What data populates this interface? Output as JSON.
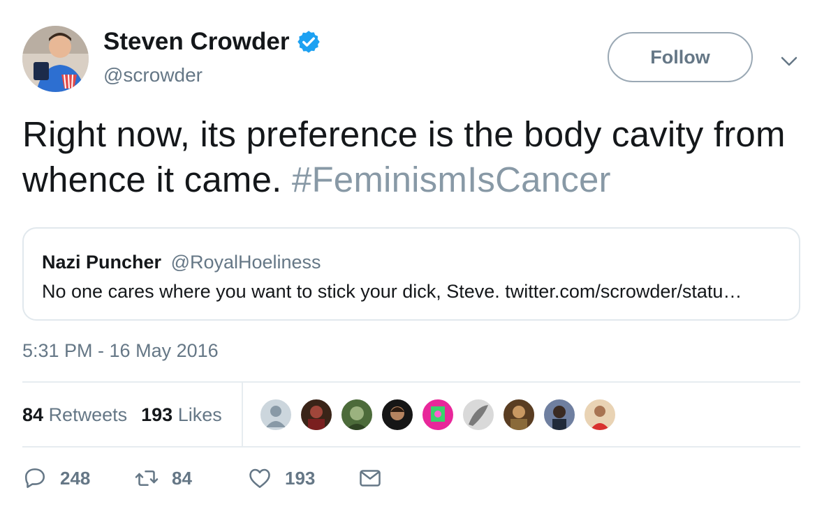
{
  "author": {
    "name": "Steven Crowder",
    "handle": "@scrowder",
    "verified": true
  },
  "follow_label": "Follow",
  "tweet": {
    "text": "Right now, its preference is the body cavity from whence it came.",
    "hashtag": "#FeminismIsCancer"
  },
  "quote": {
    "name": "Nazi Puncher",
    "handle": "@RoyalHoeliness",
    "text": "No one cares where you want to stick your dick, Steve.  twitter.com/scrowder/statu…"
  },
  "timestamp": "5:31 PM - 16 May 2016",
  "stats": {
    "retweets_count": "84",
    "retweets_label": "Retweets",
    "likes_count": "193",
    "likes_label": "Likes"
  },
  "actions": {
    "replies": "248",
    "retweets": "84",
    "likes": "193"
  },
  "colors": {
    "verified_badge": "#1da1f2",
    "secondary_text": "#657786",
    "hashtag": "#8899a6",
    "border": "#e1e8ed"
  },
  "icons": [
    "verified-badge-icon",
    "chevron-down-icon",
    "reply-icon",
    "retweet-icon",
    "like-icon",
    "direct-message-icon"
  ]
}
